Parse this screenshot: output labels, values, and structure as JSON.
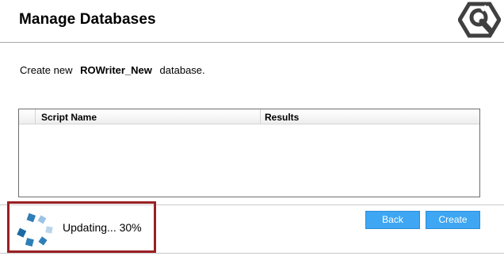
{
  "header": {
    "title": "Manage Databases"
  },
  "description": {
    "prefix": "Create new",
    "database_name": "ROWriter_New",
    "suffix": "database."
  },
  "grid": {
    "columns": [
      "Script Name",
      "Results"
    ],
    "rows": []
  },
  "buttons": {
    "back": "Back",
    "create": "Create"
  },
  "status": {
    "text": "Updating... 30%",
    "progress": 0.3
  },
  "icons": {
    "app": "wrench-hexagon-icon",
    "spinner": "loading-spinner-icon"
  },
  "colors": {
    "button_bg": "#3ea6f2",
    "highlight_border": "#9a1f24",
    "spinner_blue": "#2e7fb8"
  }
}
